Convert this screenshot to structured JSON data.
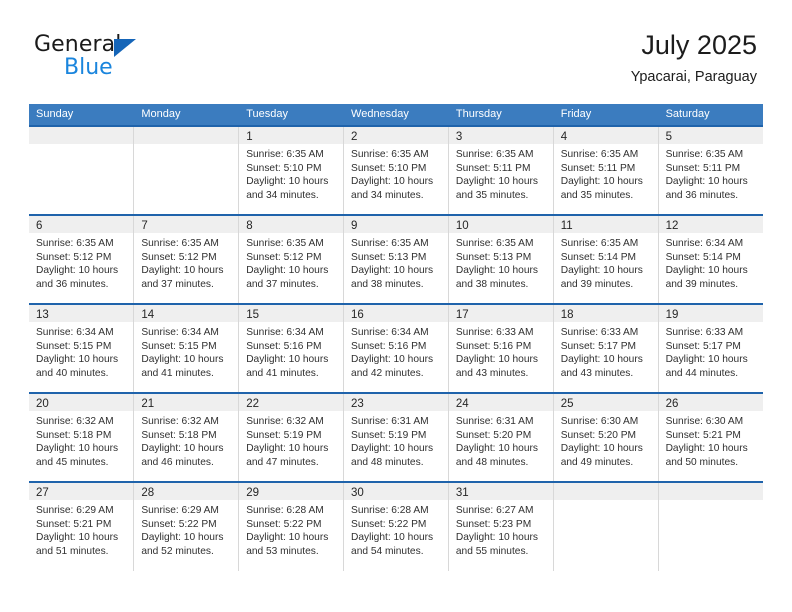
{
  "brand": {
    "name_top": "General",
    "name_bottom": "Blue",
    "triangle_icon": "triangle-right-icon",
    "accent_color": "#1565b8",
    "blue_text_color": "#1a85dd"
  },
  "header": {
    "title": "July 2025",
    "subtitle": "Ypacarai, Paraguay"
  },
  "theme": {
    "header_row_bg": "#3b7cbf",
    "row_divider": "#1f63ab",
    "daynum_band_bg": "#efefef",
    "text_color": "#303030"
  },
  "weekdays": [
    "Sunday",
    "Monday",
    "Tuesday",
    "Wednesday",
    "Thursday",
    "Friday",
    "Saturday"
  ],
  "weeks": [
    [
      {
        "day": "",
        "lines": [
          "",
          "",
          "",
          ""
        ],
        "empty": true
      },
      {
        "day": "",
        "lines": [
          "",
          "",
          "",
          ""
        ],
        "empty": true
      },
      {
        "day": "1",
        "lines": [
          "Sunrise: 6:35 AM",
          "Sunset: 5:10 PM",
          "Daylight: 10 hours",
          "and 34 minutes."
        ]
      },
      {
        "day": "2",
        "lines": [
          "Sunrise: 6:35 AM",
          "Sunset: 5:10 PM",
          "Daylight: 10 hours",
          "and 34 minutes."
        ]
      },
      {
        "day": "3",
        "lines": [
          "Sunrise: 6:35 AM",
          "Sunset: 5:11 PM",
          "Daylight: 10 hours",
          "and 35 minutes."
        ]
      },
      {
        "day": "4",
        "lines": [
          "Sunrise: 6:35 AM",
          "Sunset: 5:11 PM",
          "Daylight: 10 hours",
          "and 35 minutes."
        ]
      },
      {
        "day": "5",
        "lines": [
          "Sunrise: 6:35 AM",
          "Sunset: 5:11 PM",
          "Daylight: 10 hours",
          "and 36 minutes."
        ]
      }
    ],
    [
      {
        "day": "6",
        "lines": [
          "Sunrise: 6:35 AM",
          "Sunset: 5:12 PM",
          "Daylight: 10 hours",
          "and 36 minutes."
        ]
      },
      {
        "day": "7",
        "lines": [
          "Sunrise: 6:35 AM",
          "Sunset: 5:12 PM",
          "Daylight: 10 hours",
          "and 37 minutes."
        ]
      },
      {
        "day": "8",
        "lines": [
          "Sunrise: 6:35 AM",
          "Sunset: 5:12 PM",
          "Daylight: 10 hours",
          "and 37 minutes."
        ]
      },
      {
        "day": "9",
        "lines": [
          "Sunrise: 6:35 AM",
          "Sunset: 5:13 PM",
          "Daylight: 10 hours",
          "and 38 minutes."
        ]
      },
      {
        "day": "10",
        "lines": [
          "Sunrise: 6:35 AM",
          "Sunset: 5:13 PM",
          "Daylight: 10 hours",
          "and 38 minutes."
        ]
      },
      {
        "day": "11",
        "lines": [
          "Sunrise: 6:35 AM",
          "Sunset: 5:14 PM",
          "Daylight: 10 hours",
          "and 39 minutes."
        ]
      },
      {
        "day": "12",
        "lines": [
          "Sunrise: 6:34 AM",
          "Sunset: 5:14 PM",
          "Daylight: 10 hours",
          "and 39 minutes."
        ]
      }
    ],
    [
      {
        "day": "13",
        "lines": [
          "Sunrise: 6:34 AM",
          "Sunset: 5:15 PM",
          "Daylight: 10 hours",
          "and 40 minutes."
        ]
      },
      {
        "day": "14",
        "lines": [
          "Sunrise: 6:34 AM",
          "Sunset: 5:15 PM",
          "Daylight: 10 hours",
          "and 41 minutes."
        ]
      },
      {
        "day": "15",
        "lines": [
          "Sunrise: 6:34 AM",
          "Sunset: 5:16 PM",
          "Daylight: 10 hours",
          "and 41 minutes."
        ]
      },
      {
        "day": "16",
        "lines": [
          "Sunrise: 6:34 AM",
          "Sunset: 5:16 PM",
          "Daylight: 10 hours",
          "and 42 minutes."
        ]
      },
      {
        "day": "17",
        "lines": [
          "Sunrise: 6:33 AM",
          "Sunset: 5:16 PM",
          "Daylight: 10 hours",
          "and 43 minutes."
        ]
      },
      {
        "day": "18",
        "lines": [
          "Sunrise: 6:33 AM",
          "Sunset: 5:17 PM",
          "Daylight: 10 hours",
          "and 43 minutes."
        ]
      },
      {
        "day": "19",
        "lines": [
          "Sunrise: 6:33 AM",
          "Sunset: 5:17 PM",
          "Daylight: 10 hours",
          "and 44 minutes."
        ]
      }
    ],
    [
      {
        "day": "20",
        "lines": [
          "Sunrise: 6:32 AM",
          "Sunset: 5:18 PM",
          "Daylight: 10 hours",
          "and 45 minutes."
        ]
      },
      {
        "day": "21",
        "lines": [
          "Sunrise: 6:32 AM",
          "Sunset: 5:18 PM",
          "Daylight: 10 hours",
          "and 46 minutes."
        ]
      },
      {
        "day": "22",
        "lines": [
          "Sunrise: 6:32 AM",
          "Sunset: 5:19 PM",
          "Daylight: 10 hours",
          "and 47 minutes."
        ]
      },
      {
        "day": "23",
        "lines": [
          "Sunrise: 6:31 AM",
          "Sunset: 5:19 PM",
          "Daylight: 10 hours",
          "and 48 minutes."
        ]
      },
      {
        "day": "24",
        "lines": [
          "Sunrise: 6:31 AM",
          "Sunset: 5:20 PM",
          "Daylight: 10 hours",
          "and 48 minutes."
        ]
      },
      {
        "day": "25",
        "lines": [
          "Sunrise: 6:30 AM",
          "Sunset: 5:20 PM",
          "Daylight: 10 hours",
          "and 49 minutes."
        ]
      },
      {
        "day": "26",
        "lines": [
          "Sunrise: 6:30 AM",
          "Sunset: 5:21 PM",
          "Daylight: 10 hours",
          "and 50 minutes."
        ]
      }
    ],
    [
      {
        "day": "27",
        "lines": [
          "Sunrise: 6:29 AM",
          "Sunset: 5:21 PM",
          "Daylight: 10 hours",
          "and 51 minutes."
        ]
      },
      {
        "day": "28",
        "lines": [
          "Sunrise: 6:29 AM",
          "Sunset: 5:22 PM",
          "Daylight: 10 hours",
          "and 52 minutes."
        ]
      },
      {
        "day": "29",
        "lines": [
          "Sunrise: 6:28 AM",
          "Sunset: 5:22 PM",
          "Daylight: 10 hours",
          "and 53 minutes."
        ]
      },
      {
        "day": "30",
        "lines": [
          "Sunrise: 6:28 AM",
          "Sunset: 5:22 PM",
          "Daylight: 10 hours",
          "and 54 minutes."
        ]
      },
      {
        "day": "31",
        "lines": [
          "Sunrise: 6:27 AM",
          "Sunset: 5:23 PM",
          "Daylight: 10 hours",
          "and 55 minutes."
        ]
      },
      {
        "day": "",
        "lines": [
          "",
          "",
          "",
          ""
        ],
        "empty": true
      },
      {
        "day": "",
        "lines": [
          "",
          "",
          "",
          ""
        ],
        "empty": true
      }
    ]
  ]
}
